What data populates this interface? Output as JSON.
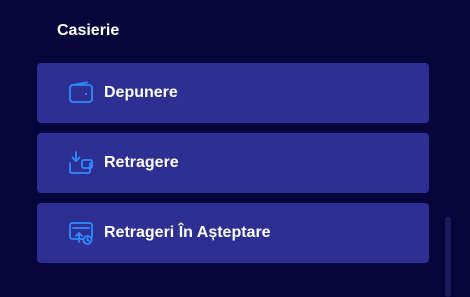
{
  "cashier": {
    "title": "Casierie",
    "items": [
      {
        "label": "Depunere",
        "icon": "wallet-icon"
      },
      {
        "label": "Retragere",
        "icon": "withdraw-icon"
      },
      {
        "label": "Retrageri În Așteptare",
        "icon": "pending-withdrawals-icon"
      }
    ]
  },
  "colors": {
    "background": "#07063a",
    "item_background": "#2e2f92",
    "icon_accent": "#2f8bff",
    "text": "#ffffff"
  }
}
